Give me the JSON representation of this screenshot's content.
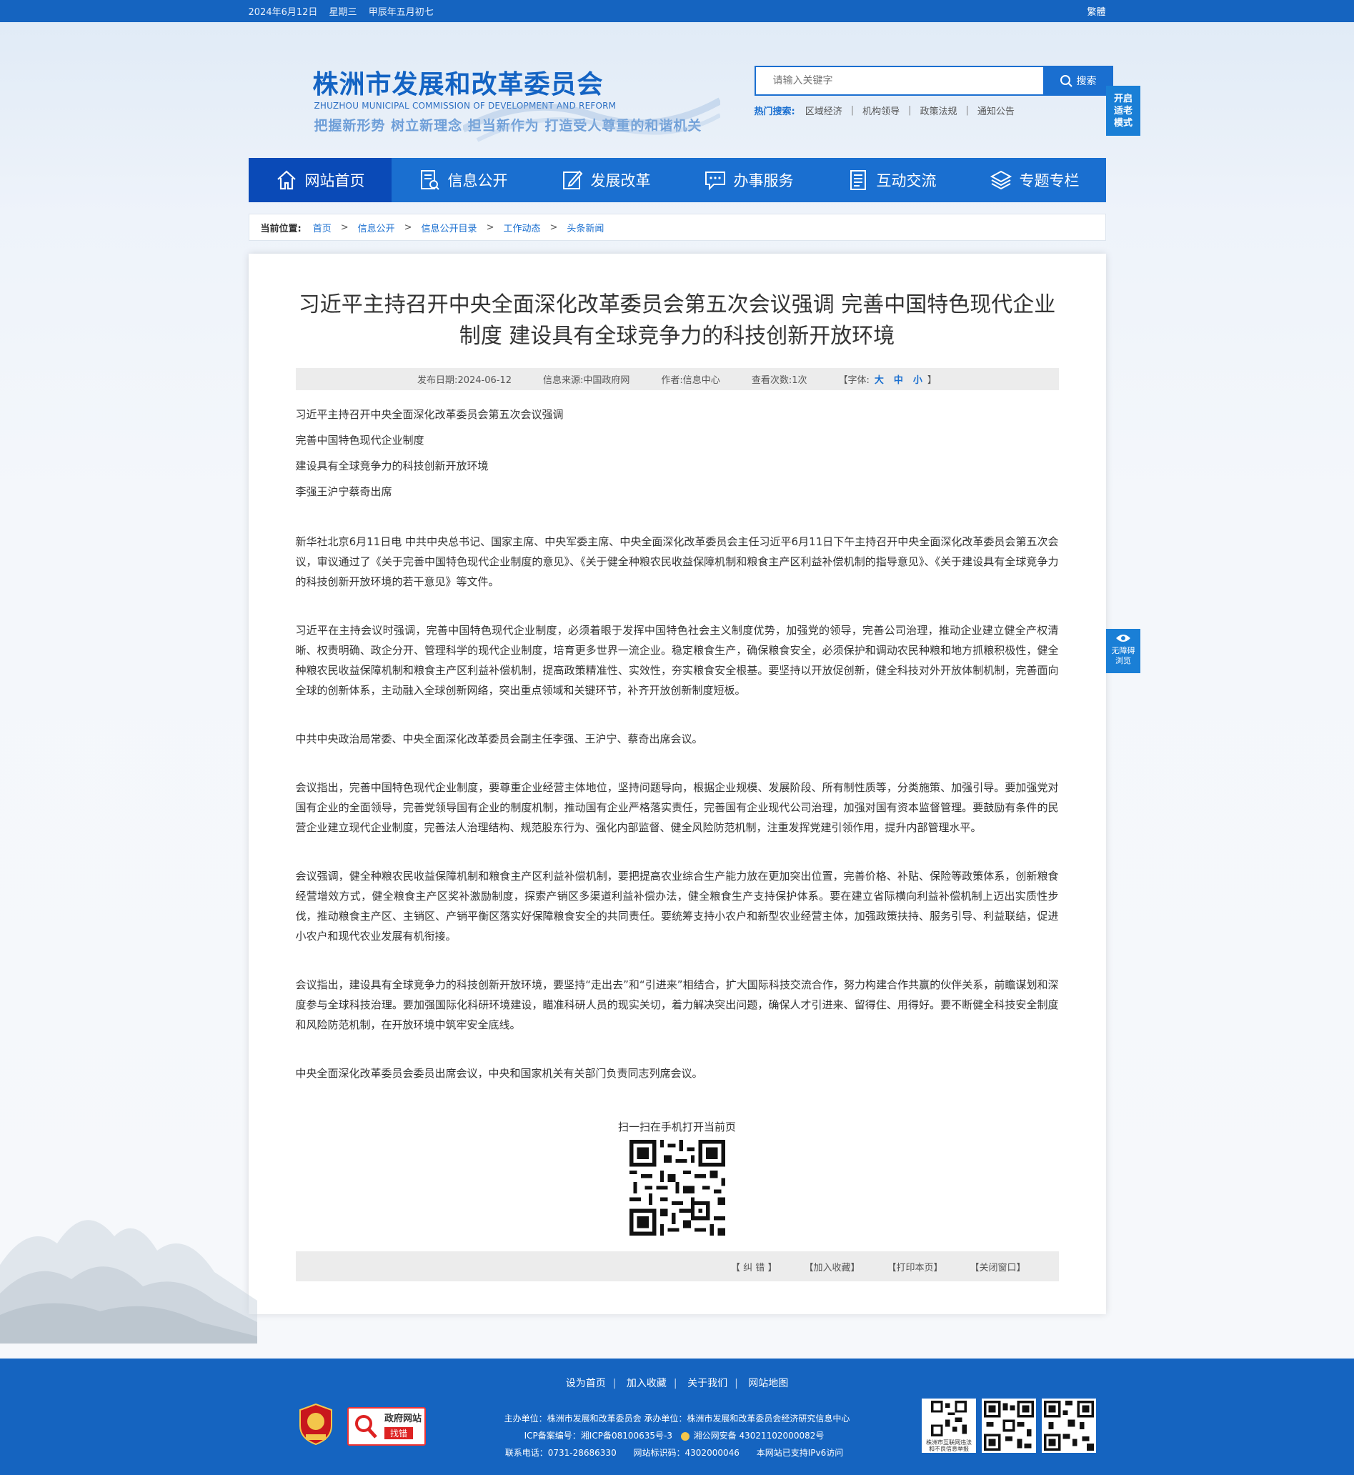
{
  "topbar": {
    "date": "2024年6月12日",
    "weekday": "星期三",
    "lunar": "甲辰年五月初七",
    "traditional": "繁體"
  },
  "header": {
    "title": "株洲市发展和改革委员会",
    "title_en": "ZHUZHOU MUNICIPAL COMMISSION OF DEVELOPMENT AND REFORM",
    "slogan": "把握新形势 树立新理念 担当新作为 打造受人尊重的和谐机关",
    "search_placeholder": "请输入关键字",
    "search_button": "搜索",
    "hot_label": "热门搜索:",
    "hot_items": [
      "区域经济",
      "机构领导",
      "政策法规",
      "通知公告"
    ],
    "elder_mode": [
      "开启",
      "适老",
      "模式"
    ]
  },
  "nav": {
    "items": [
      {
        "label": "网站首页",
        "icon": "home-icon"
      },
      {
        "label": "信息公开",
        "icon": "document-search-icon"
      },
      {
        "label": "发展改革",
        "icon": "edit-icon"
      },
      {
        "label": "办事服务",
        "icon": "chat-icon"
      },
      {
        "label": "互动交流",
        "icon": "report-icon"
      },
      {
        "label": "专题专栏",
        "icon": "layers-icon"
      }
    ]
  },
  "breadcrumb": {
    "label": "当前位置:",
    "items": [
      "首页",
      "信息公开",
      "信息公开目录",
      "工作动态",
      "头条新闻"
    ]
  },
  "article": {
    "title": "习近平主持召开中央全面深化改革委员会第五次会议强调 完善中国特色现代企业制度 建设具有全球竞争力的科技创新开放环境",
    "meta": {
      "date_label": "发布日期:",
      "date": "2024-06-12",
      "source_label": "信息来源:",
      "source": "中国政府网",
      "author_label": "作者:",
      "author": "信息中心",
      "views_label": "查看次数:",
      "views": "1次",
      "font_label": "【字体:",
      "font_large": "大",
      "font_medium": "中",
      "font_small": "小",
      "font_end": "】"
    },
    "subtitles": [
      "习近平主持召开中央全面深化改革委员会第五次会议强调",
      "完善中国特色现代企业制度",
      "建设具有全球竞争力的科技创新开放环境",
      "李强王沪宁蔡奇出席"
    ],
    "paragraphs": [
      "新华社北京6月11日电  中共中央总书记、国家主席、中央军委主席、中央全面深化改革委员会主任习近平6月11日下午主持召开中央全面深化改革委员会第五次会议，审议通过了《关于完善中国特色现代企业制度的意见》、《关于健全种粮农民收益保障机制和粮食主产区利益补偿机制的指导意见》、《关于建设具有全球竞争力的科技创新开放环境的若干意见》等文件。",
      "习近平在主持会议时强调，完善中国特色现代企业制度，必须着眼于发挥中国特色社会主义制度优势，加强党的领导，完善公司治理，推动企业建立健全产权清晰、权责明确、政企分开、管理科学的现代企业制度，培育更多世界一流企业。稳定粮食生产，确保粮食安全，必须保护和调动农民种粮和地方抓粮积极性，健全种粮农民收益保障机制和粮食主产区利益补偿机制，提高政策精准性、实效性，夯实粮食安全根基。要坚持以开放促创新，健全科技对外开放体制机制，完善面向全球的创新体系，主动融入全球创新网络，突出重点领域和关键环节，补齐开放创新制度短板。",
      "中共中央政治局常委、中央全面深化改革委员会副主任李强、王沪宁、蔡奇出席会议。",
      "会议指出，完善中国特色现代企业制度，要尊重企业经营主体地位，坚持问题导向，根据企业规模、发展阶段、所有制性质等，分类施策、加强引导。要加强党对国有企业的全面领导，完善党领导国有企业的制度机制，推动国有企业严格落实责任，完善国有企业现代公司治理，加强对国有资本监督管理。要鼓励有条件的民营企业建立现代企业制度，完善法人治理结构、规范股东行为、强化内部监督、健全风险防范机制，注重发挥党建引领作用，提升内部管理水平。",
      "会议强调，健全种粮农民收益保障机制和粮食主产区利益补偿机制，要把提高农业综合生产能力放在更加突出位置，完善价格、补贴、保险等政策体系，创新粮食经营增效方式，健全粮食主产区奖补激励制度，探索产销区多渠道利益补偿办法，健全粮食生产支持保护体系。要在建立省际横向利益补偿机制上迈出实质性步伐，推动粮食主产区、主销区、产销平衡区落实好保障粮食安全的共同责任。要统筹支持小农户和新型农业经营主体，加强政策扶持、服务引导、利益联结，促进小农户和现代农业发展有机衔接。",
      "会议指出，建设具有全球竞争力的科技创新开放环境，要坚持“走出去”和“引进来”相结合，扩大国际科技交流合作，努力构建合作共赢的伙伴关系，前瞻谋划和深度参与全球科技治理。要加强国际化科研环境建设，瞄准科研人员的现实关切，着力解决突出问题，确保人才引进来、留得住、用得好。要不断健全科技安全制度和风险防范机制，在开放环境中筑牢安全底线。",
      "中央全面深化改革委员会委员出席会议，中央和国家机关有关部门负责同志列席会议。"
    ],
    "qr_caption": "扫一扫在手机打开当前页",
    "actions": [
      "【 纠 错 】",
      "【加入收藏】",
      "【打印本页】",
      "【关闭窗口】"
    ]
  },
  "accessibility": [
    "无障碍",
    "浏览"
  ],
  "footer": {
    "links": [
      "设为首页",
      "加入收藏",
      "关于我们",
      "网站地图"
    ],
    "host": "主办单位：株洲市发展和改革委员会 承办单位：株洲市发展和改革委员会经济研究信息中心",
    "icp": "ICP备案编号：湘ICP备08100635号-3",
    "police": "湘公网安备 43021102000082号",
    "phone": "联系电话：0731-28686330",
    "site_code": "网站标识码：4302000046",
    "ipv6": "本网站已支持IPv6访问",
    "badge_text_1": "政府网站",
    "badge_text_2": "找错",
    "qr1_caption": "株洲市互联网违法和不良信息举报"
  },
  "colors": {
    "primary": "#1a6fd0",
    "nav_active": "#0a4ab7",
    "topbar": "#1564c0"
  }
}
